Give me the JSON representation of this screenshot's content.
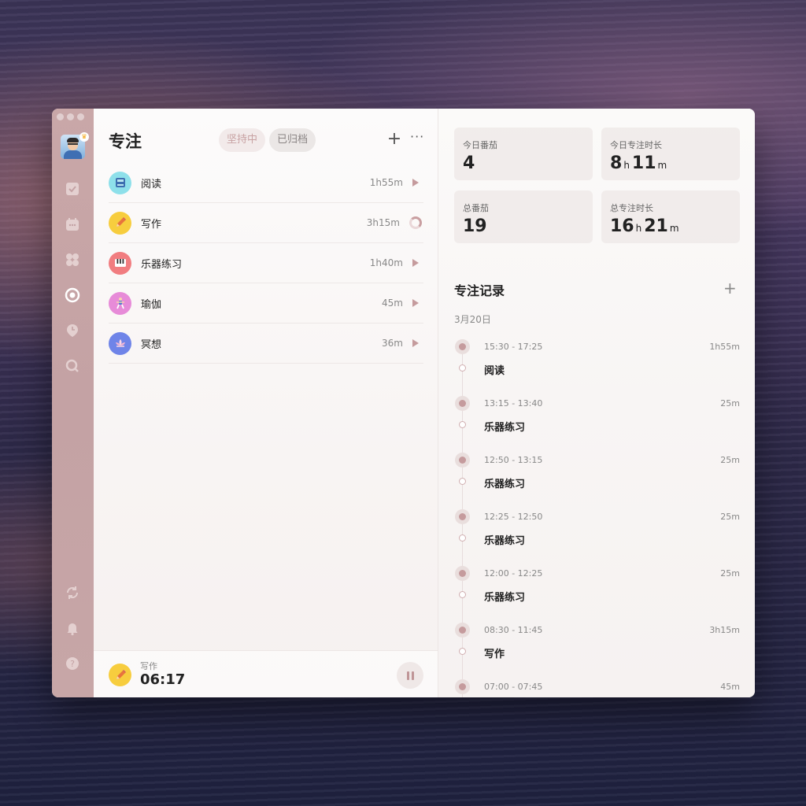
{
  "header": {
    "title": "专注",
    "tab_active": "坚持中",
    "tab_archived": "已归档",
    "add_label": "+",
    "more_label": "···"
  },
  "sidebar": {
    "icons": [
      "checkbox-icon",
      "calendar-icon",
      "four-squares-icon",
      "focus-icon",
      "pin-clock-icon",
      "search-icon",
      "sync-icon",
      "bell-icon",
      "help-icon"
    ]
  },
  "tasks": [
    {
      "name": "阅读",
      "duration": "1h55m",
      "icon": "book-icon",
      "color": "#8ee0ea",
      "control": "play"
    },
    {
      "name": "写作",
      "duration": "3h15m",
      "icon": "pencil-icon",
      "color": "#f7cd3e",
      "control": "progress-ring"
    },
    {
      "name": "乐器练习",
      "duration": "1h40m",
      "icon": "piano-icon",
      "color": "#f17d80",
      "control": "play"
    },
    {
      "name": "瑜伽",
      "duration": "45m",
      "icon": "yoga-icon",
      "color": "#e78bd8",
      "control": "play"
    },
    {
      "name": "冥想",
      "duration": "36m",
      "icon": "lotus-icon",
      "color": "#6f84e8",
      "control": "play"
    }
  ],
  "current": {
    "label": "写作",
    "time": "06:17"
  },
  "stats": {
    "today_pomodoro_label": "今日番茄",
    "today_pomodoro_value": "4",
    "today_focus_label": "今日专注时长",
    "today_focus_h": "8",
    "today_focus_m": "11",
    "total_pomodoro_label": "总番茄",
    "total_pomodoro_value": "19",
    "total_focus_label": "总专注时长",
    "total_focus_h": "16",
    "total_focus_m": "21",
    "unit_h": "h",
    "unit_m": "m"
  },
  "records": {
    "title": "专注记录",
    "add_label": "+",
    "date": "3月20日",
    "items": [
      {
        "time": "15:30 - 17:25",
        "duration": "1h55m",
        "name": "阅读"
      },
      {
        "time": "13:15 - 13:40",
        "duration": "25m",
        "name": "乐器练习"
      },
      {
        "time": "12:50 - 13:15",
        "duration": "25m",
        "name": "乐器练习"
      },
      {
        "time": "12:25 - 12:50",
        "duration": "25m",
        "name": "乐器练习"
      },
      {
        "time": "12:00 - 12:25",
        "duration": "25m",
        "name": "乐器练习"
      },
      {
        "time": "08:30 - 11:45",
        "duration": "3h15m",
        "name": "写作"
      },
      {
        "time": "07:00 - 07:45",
        "duration": "45m",
        "name": ""
      }
    ]
  }
}
